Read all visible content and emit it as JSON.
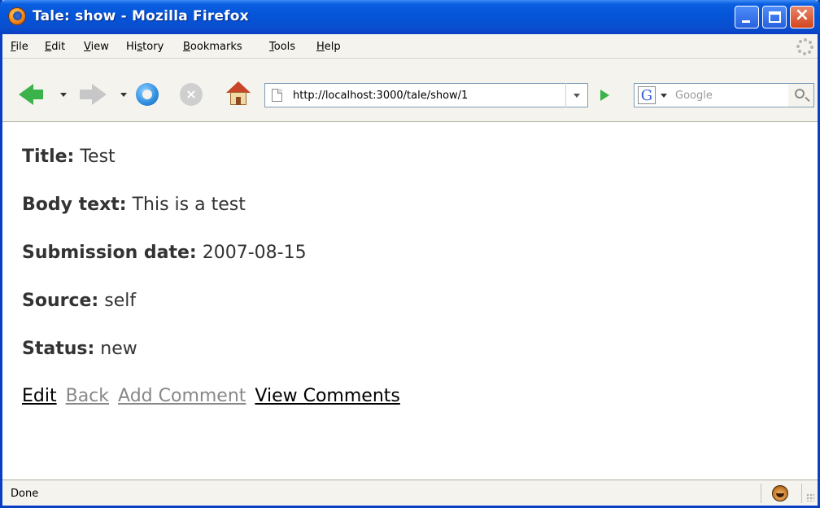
{
  "window": {
    "title": "Tale: show - Mozilla Firefox"
  },
  "menu": {
    "items": [
      {
        "label": "File",
        "accel": "F"
      },
      {
        "label": "Edit",
        "accel": "E"
      },
      {
        "label": "View",
        "accel": "V"
      },
      {
        "label": "History",
        "accel": "s"
      },
      {
        "label": "Bookmarks",
        "accel": "B"
      },
      {
        "label": "Tools",
        "accel": "T"
      },
      {
        "label": "Help",
        "accel": "H"
      }
    ]
  },
  "toolbar": {
    "url": "http://localhost:3000/tale/show/1",
    "search_placeholder": "Google",
    "search_engine_letter": "G"
  },
  "page": {
    "fields": [
      {
        "label": "Title:",
        "value": "Test"
      },
      {
        "label": "Body text:",
        "value": "This is a test"
      },
      {
        "label": "Submission date:",
        "value": "2007-08-15"
      },
      {
        "label": "Source:",
        "value": "self"
      },
      {
        "label": "Status:",
        "value": "new"
      }
    ],
    "links": [
      {
        "label": "Edit",
        "visited": false
      },
      {
        "label": "Back",
        "visited": true
      },
      {
        "label": "Add Comment",
        "visited": true
      },
      {
        "label": "View Comments",
        "visited": false
      }
    ]
  },
  "status": {
    "text": "Done"
  },
  "colors": {
    "titlebar": "#0454d8",
    "link": "#000000",
    "visited_link": "#888888",
    "chrome": "#f4f3ee"
  }
}
